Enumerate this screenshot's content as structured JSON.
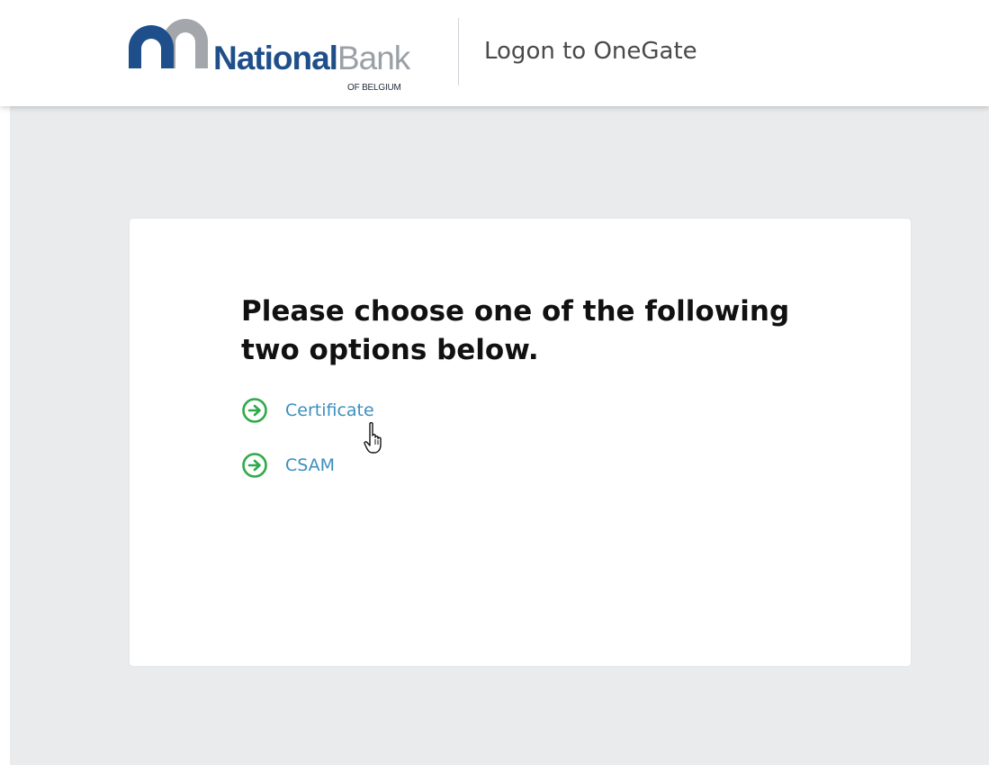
{
  "header": {
    "logo": {
      "brand_bold": "National",
      "brand_light": "Bank",
      "subtitle": "OF BELGIUM"
    },
    "title": "Logon to OneGate"
  },
  "card": {
    "heading": "Please choose one of the following two options below.",
    "options": [
      {
        "label": "Certificate",
        "icon": "arrow-right-circle-icon"
      },
      {
        "label": "CSAM",
        "icon": "arrow-right-circle-icon"
      }
    ]
  },
  "colors": {
    "brand_blue": "#1f4f8a",
    "brand_gray": "#9aa0a6",
    "link": "#3d8fbd",
    "option_icon": "#2eaa4a",
    "background": "#e9ebed"
  },
  "cursor": {
    "icon": "hand-pointer-icon"
  }
}
